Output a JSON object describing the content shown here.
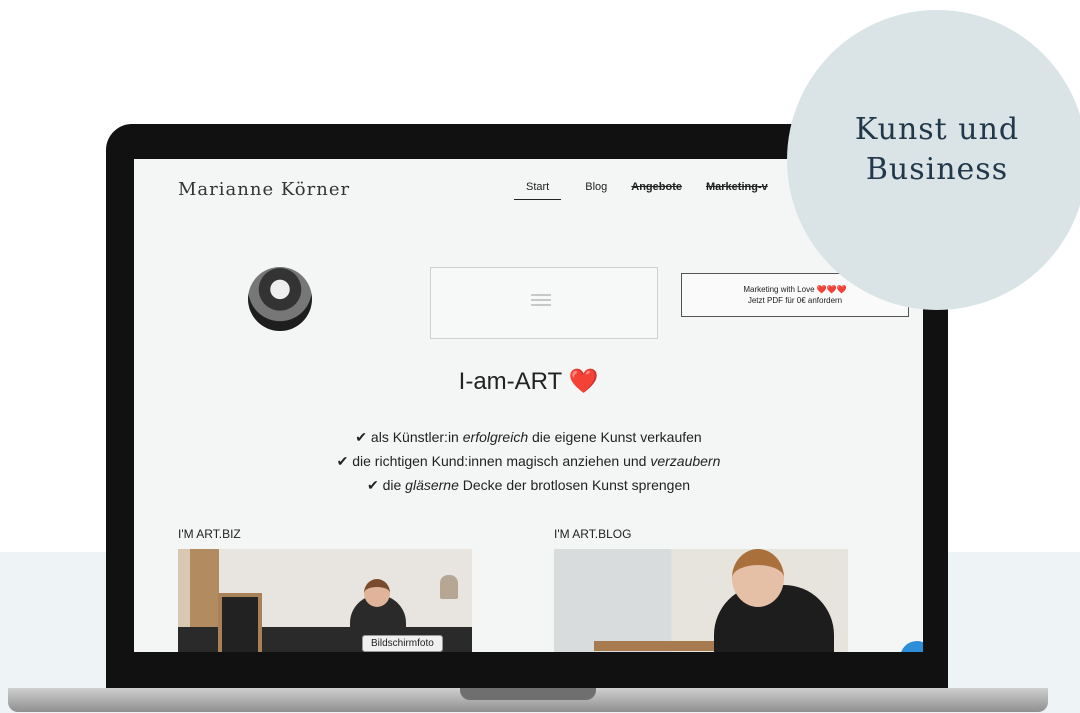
{
  "site": {
    "brand": "Marianne Körner",
    "nav": [
      {
        "label": "Start",
        "active": true,
        "struck": false
      },
      {
        "label": "Blog",
        "active": false,
        "struck": false
      },
      {
        "label": "Angebote",
        "active": false,
        "struck": true
      },
      {
        "label": "Marketing-v",
        "active": false,
        "struck": true
      }
    ]
  },
  "cta": {
    "line1": "Marketing with Love ❤️❤️❤️",
    "line2": "Jetzt PDF für 0€ anfordern"
  },
  "hero": {
    "title": "I-am-ART ❤️",
    "check1_pre": "✔ als Künstler:in ",
    "check1_em": "erfolgreich",
    "check1_post": " die eigene Kunst verkaufen",
    "check2_pre": "✔ die richtigen Kund:innen magisch anziehen und ",
    "check2_em": "verzaubern",
    "check3_pre": "✔ die ",
    "check3_em": "gläserne",
    "check3_post": " Decke der brotlosen Kunst sprengen"
  },
  "sections": {
    "left_label": "I'M ART.BIZ",
    "right_label": "I'M ART.BLOG"
  },
  "tooltip": "Bildschirmfoto",
  "badge": {
    "line1": "Kunst und",
    "line2": "Business"
  },
  "colors": {
    "badge_bg": "#dae4e7",
    "band_bg": "#eef3f5",
    "chat_accent": "#2d8fd9"
  }
}
